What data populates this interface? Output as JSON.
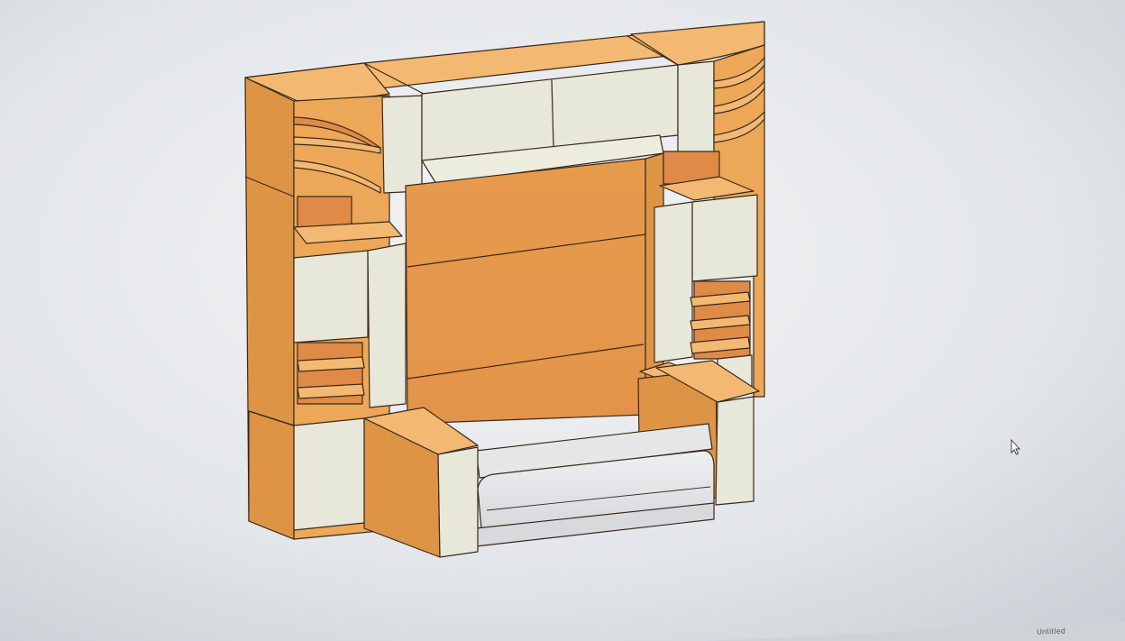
{
  "colors": {
    "wood_front": "#eda758",
    "wood_side": "#de9445",
    "wood_top": "#f3b872",
    "wood_inner": "#e08a48",
    "door_face": "#e7e7da",
    "door_edge": "#d2d2c4",
    "mattress": "#e5e6e8",
    "outline": "#3a2a1a",
    "screen_bg": "#e6e9ec"
  },
  "icons": {
    "cursor": "mouse-cursor-icon"
  },
  "taskbar": {
    "label": "Untitled"
  }
}
